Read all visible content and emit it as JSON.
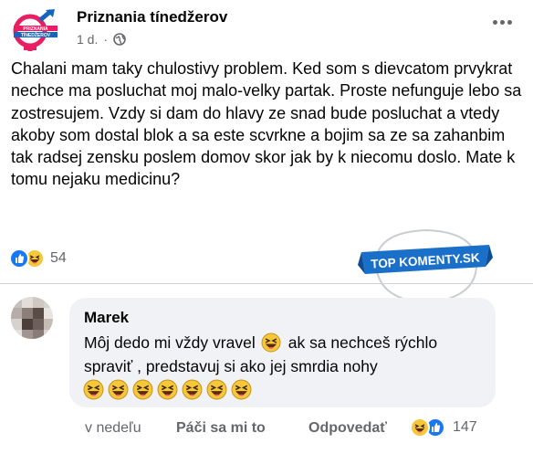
{
  "post": {
    "page_name": "Priznania tínedžerov",
    "logo_text": "Priznania tínedžerov",
    "time": "1 d.",
    "separator": "·",
    "text": "Chalani mam taky chulostivy problem. Ked som s dievcatom prvykrat nechce ma posluchat moj malo-velky partak. Proste nefunguje lebo sa zostresujem. Vzdy si dam do hlavy ze snad bude posluchat a vtedy akoby som dostal blok a sa este scvrkne a bojim sa ze sa zahanbim tak radsej zensku poslem domov skor jak by k niecomu doslo. Mate k tomu nejaku medicinu?",
    "reaction_count": "54"
  },
  "watermark": {
    "text": "TOP KOMENTY.SK"
  },
  "comment": {
    "author": "Marek",
    "line1_a": "Môj dedo mi vždy vravel",
    "line1_b": "ak sa nechceš rýchlo",
    "line2": "spraviť , predstavuj si ako jej smrdia nohy",
    "emoji_count": 7,
    "time": "v nedeľu",
    "like_label": "Páči sa mi to",
    "reply_label": "Odpovedať",
    "reaction_count": "147"
  },
  "colors": {
    "facebook_blue": "#1877f2",
    "secondary_text": "#65676b",
    "bubble_bg": "#f0f2f5",
    "badge_blue": "#1a6fc9",
    "logo_pink": "#e91e63"
  }
}
